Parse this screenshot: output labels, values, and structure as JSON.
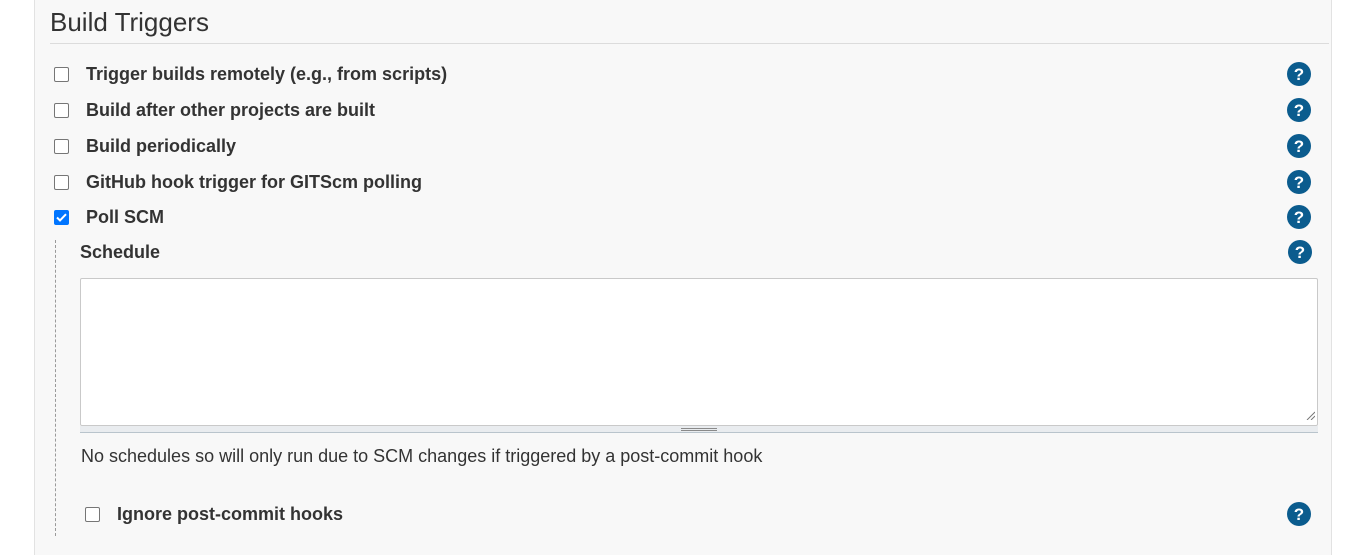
{
  "section": {
    "title": "Build Triggers"
  },
  "triggers": [
    {
      "label": "Trigger builds remotely (e.g., from scripts)",
      "checked": false
    },
    {
      "label": "Build after other projects are built",
      "checked": false
    },
    {
      "label": "Build periodically",
      "checked": false
    },
    {
      "label": "GitHub hook trigger for GITScm polling",
      "checked": false
    },
    {
      "label": "Poll SCM",
      "checked": true
    }
  ],
  "poll_scm": {
    "schedule_label": "Schedule",
    "schedule_value": "",
    "schedule_note": "No schedules so will only run due to SCM changes if triggered by a post-commit hook",
    "ignore_hooks": {
      "label": "Ignore post-commit hooks",
      "checked": false
    }
  },
  "help": {
    "glyph": "?",
    "icon": "help-icon",
    "color": "#0b5c8e"
  },
  "colors": {
    "checkbox_checked": "#0075ff"
  }
}
